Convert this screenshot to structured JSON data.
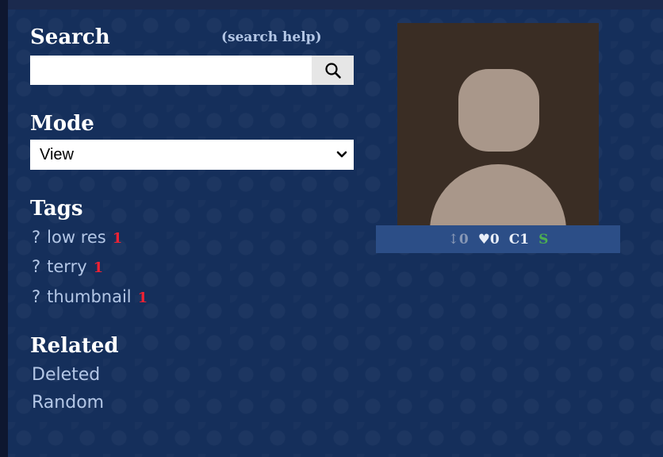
{
  "search": {
    "heading": "Search",
    "help_link": "(search help)",
    "input_value": "",
    "button_icon": "magnifier-icon"
  },
  "mode": {
    "heading": "Mode",
    "selected": "View"
  },
  "tags": {
    "heading": "Tags",
    "items": [
      {
        "q": "?",
        "name": "low res",
        "count": "1"
      },
      {
        "q": "?",
        "name": "terry",
        "count": "1"
      },
      {
        "q": "?",
        "name": "thumbnail",
        "count": "1"
      }
    ]
  },
  "related": {
    "heading": "Related",
    "links": [
      "Deleted",
      "Random"
    ]
  },
  "post": {
    "thumbnail_icon": "default-avatar-icon",
    "score_arrow": "↕",
    "score": "0",
    "favorites": "♥0",
    "comments": "C1",
    "rating": "S"
  },
  "colors": {
    "panel_background": "#152f5b",
    "link": "#b4c7e6",
    "tag_count": "#ee2233",
    "rating_safe": "#4caf50",
    "stats_bar": "#2c4e87",
    "thumbnail_bg": "#3a2d24",
    "avatar_fg": "#a9978a"
  }
}
